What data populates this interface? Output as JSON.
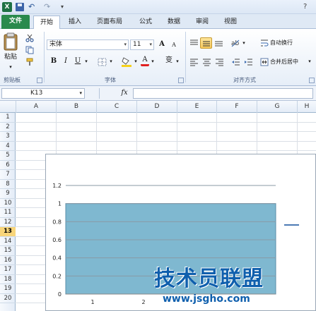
{
  "qat": {
    "logo": "X",
    "undo": "↶",
    "redo": "↷",
    "more": "▾",
    "window_btn": "?"
  },
  "tabs": [
    {
      "label": "文件"
    },
    {
      "label": "开始"
    },
    {
      "label": "插入"
    },
    {
      "label": "页面布局"
    },
    {
      "label": "公式"
    },
    {
      "label": "数据"
    },
    {
      "label": "审阅"
    },
    {
      "label": "视图"
    }
  ],
  "ribbon": {
    "clipboard": {
      "paste_label": "粘贴",
      "group_label": "剪贴板"
    },
    "font": {
      "name": "宋体",
      "size": "11",
      "grow": "A",
      "shrink": "A",
      "bold": "B",
      "italic": "I",
      "underline": "U",
      "font_color": "A",
      "wen": "变",
      "group_label": "字体"
    },
    "alignment": {
      "wrap_text": "自动换行",
      "merge_center": "合并后居中",
      "group_label": "对齐方式"
    }
  },
  "formula_bar": {
    "name_box": "K13",
    "fx": "fx",
    "value": ""
  },
  "grid": {
    "columns": [
      "A",
      "B",
      "C",
      "D",
      "E",
      "F",
      "G",
      "H"
    ],
    "rows": [
      "1",
      "2",
      "3",
      "4",
      "5",
      "6",
      "7",
      "8",
      "9",
      "10",
      "11",
      "12",
      "13",
      "14",
      "15",
      "16",
      "17",
      "18",
      "19",
      "20"
    ],
    "selected_row": "13"
  },
  "chart_data": {
    "type": "area",
    "categories": [
      "1",
      "2"
    ],
    "values": [
      1,
      1
    ],
    "ylim": [
      0,
      1.2
    ],
    "yticks": [
      "1.2",
      "1",
      "0.8",
      "0.6",
      "0.4",
      "0.2",
      "0"
    ],
    "fill_color": "#7fb8d0",
    "legend_color": "#4c7ab4"
  },
  "watermark": {
    "title": "技术员联盟",
    "url": "www.jsgho.com"
  }
}
